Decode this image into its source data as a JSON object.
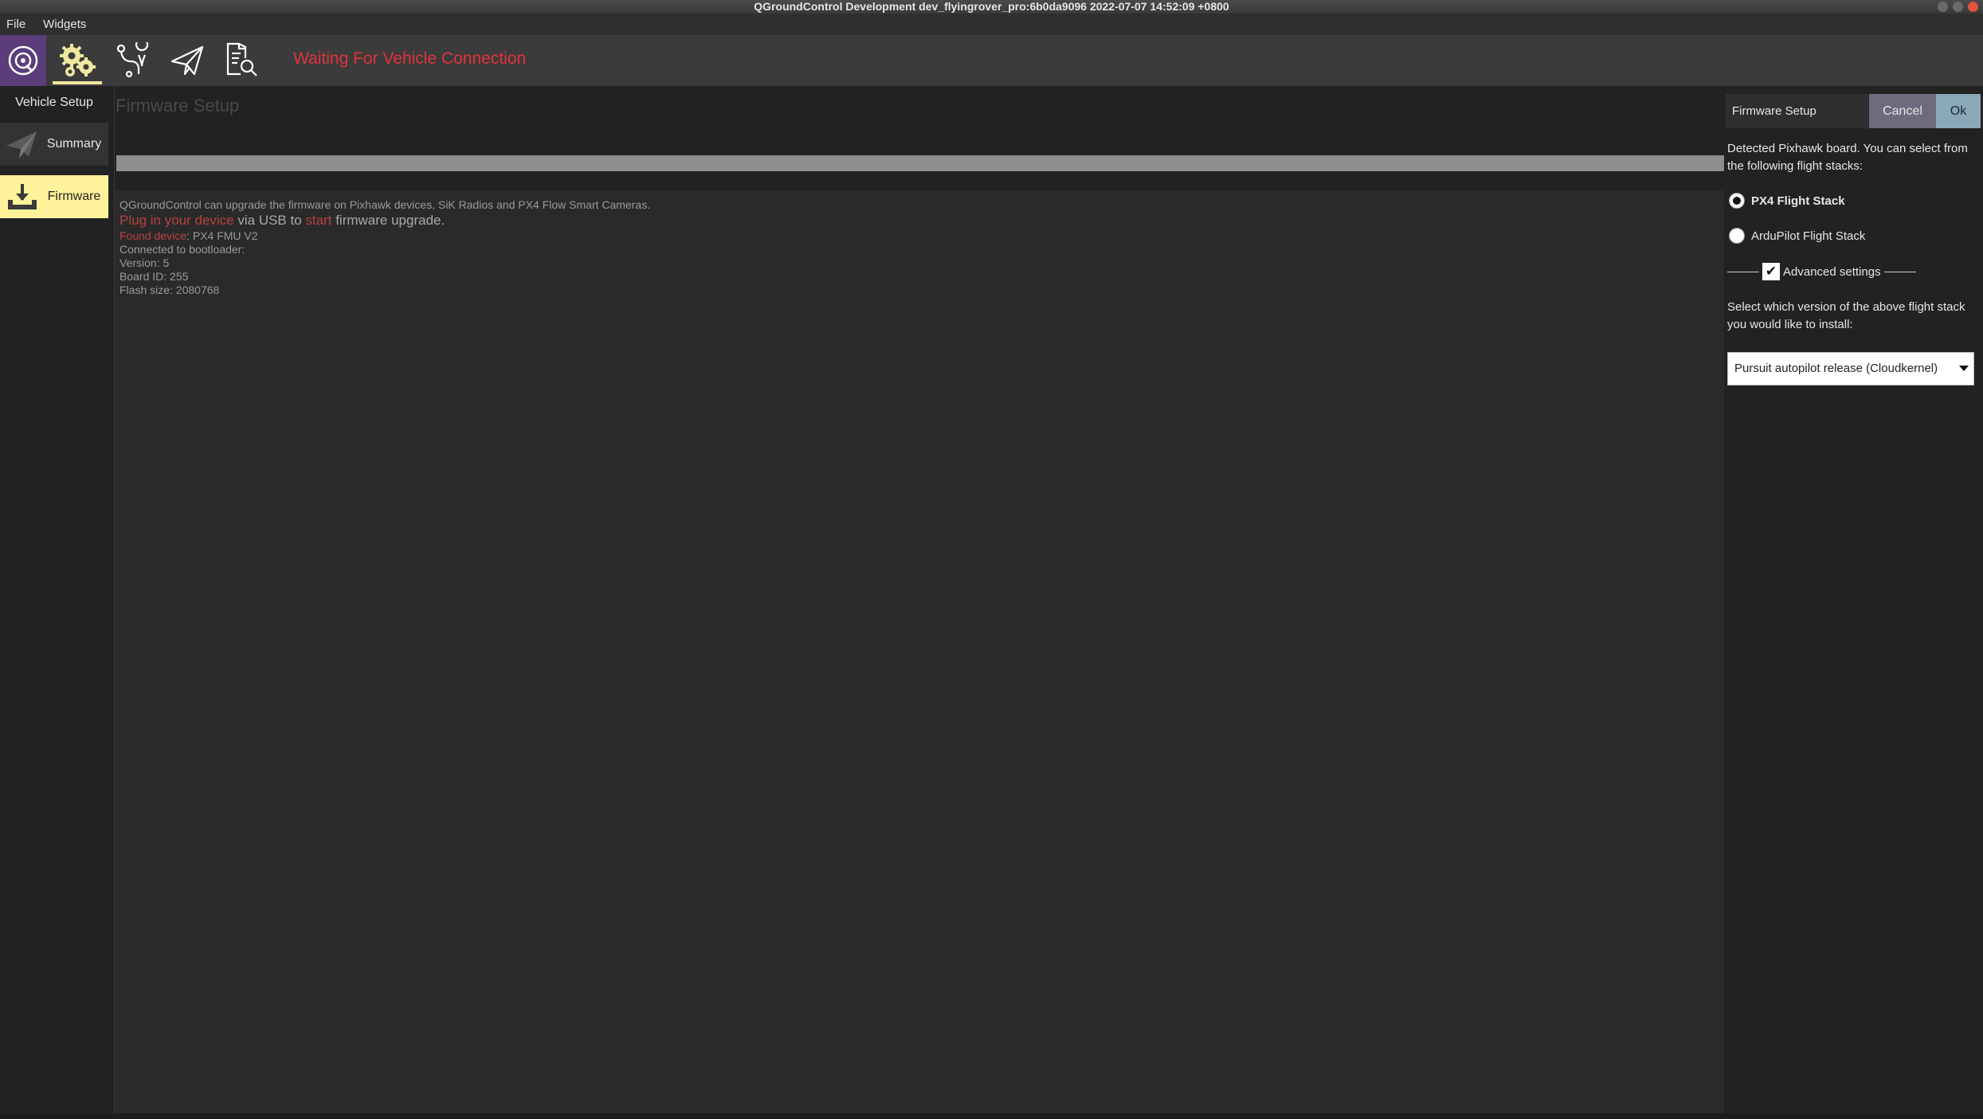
{
  "window": {
    "title": "QGroundControl Development dev_flyingrover_pro:6b0da9096 2022-07-07 14:52:09 +0800"
  },
  "menu": {
    "items": [
      "File",
      "Widgets"
    ]
  },
  "toolbar": {
    "status": "Waiting For Vehicle Connection",
    "icons": [
      "qgc-logo-icon",
      "vehicle-setup-gears-icon",
      "plan-view-icon",
      "fly-view-icon",
      "analyze-view-icon"
    ]
  },
  "sidebar": {
    "title": "Vehicle Setup",
    "items": [
      {
        "label": "Summary",
        "icon": "paper-plane-icon",
        "selected": false
      },
      {
        "label": "Firmware",
        "icon": "download-icon",
        "selected": true
      }
    ]
  },
  "main": {
    "title": "Firmware Setup",
    "progress": 1.0,
    "log": {
      "intro": "QGroundControl can upgrade the firmware on Pixhawk devices, SiK Radios and PX4 Flow Smart Cameras.",
      "plug_red": "Plug in your device",
      "plug_mid": " via USB to ",
      "plug_start": "start",
      "plug_end": " firmware upgrade.",
      "found_label": "Found device",
      "found_value": ": PX4 FMU V2",
      "line_bootloader": "Connected to bootloader:",
      "line_version": "Version: 5",
      "line_board": "Board ID: 255",
      "line_flash": "Flash size: 2080768"
    }
  },
  "dialog": {
    "title": "Firmware Setup",
    "cancel": "Cancel",
    "ok": "Ok",
    "detected": "Detected Pixhawk board. You can select from the following flight stacks:",
    "options": [
      {
        "label": "PX4 Flight Stack",
        "checked": true
      },
      {
        "label": "ArduPilot Flight Stack",
        "checked": false
      }
    ],
    "advanced_label": "Advanced settings",
    "advanced_checked": true,
    "select_prompt": "Select which version of the above flight stack you would like to install:",
    "selected_version": "Pursuit autopilot release (Cloudkernel)"
  },
  "colors": {
    "accent_yellow": "#fff29a",
    "status_red": "#e0333a",
    "logo_purple": "#5a3d7a"
  }
}
